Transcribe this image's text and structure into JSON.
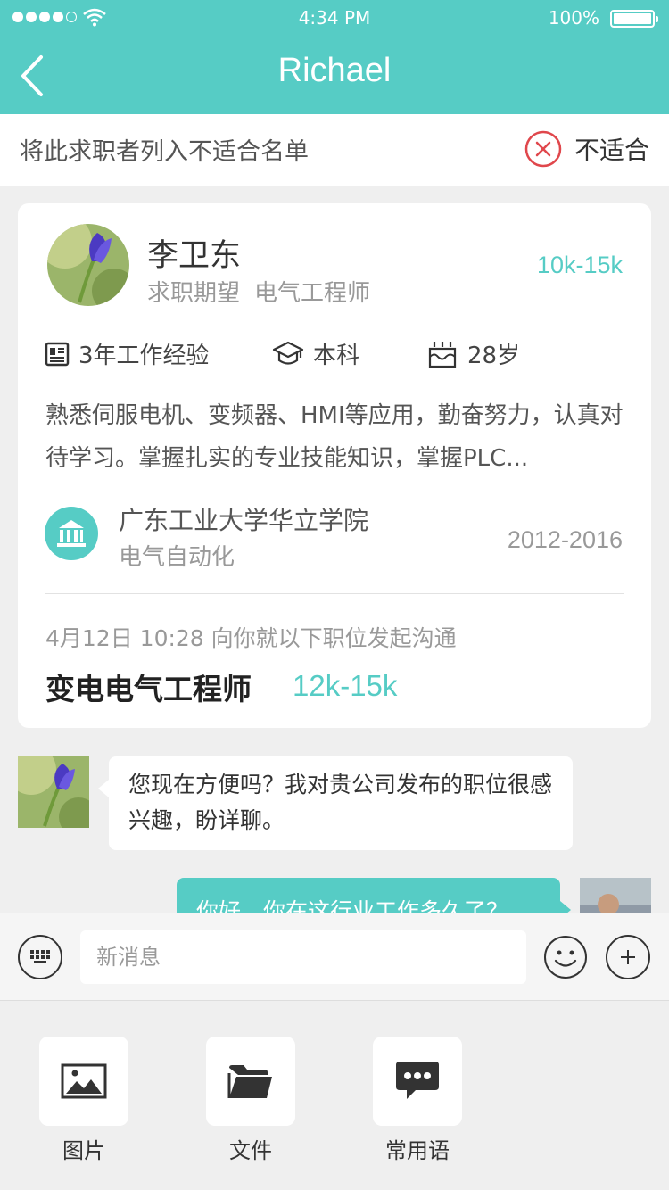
{
  "status_bar": {
    "time": "4:34 PM",
    "battery": "100%"
  },
  "nav": {
    "title": "Richael"
  },
  "reject_bar": {
    "text": "将此求职者列入不适合名单",
    "button_label": "不适合"
  },
  "candidate": {
    "name": "李卫东",
    "expect_label": "求职期望",
    "expect_position": "电气工程师",
    "salary": "10k-15k",
    "experience": "3年工作经验",
    "education": "本科",
    "age": "28岁",
    "description": "熟悉伺服电机、变频器、HMI等应用，勤奋努力，认真对待学习。掌握扎实的专业技能知识，掌握PLC...",
    "school": "广东工业大学华立学院",
    "major": "电气自动化",
    "years": "2012-2016"
  },
  "conversation_start": {
    "text": "4月12日 10:28 向你就以下职位发起沟通",
    "job_title": "变电电气工程师",
    "job_salary": "12k-15k"
  },
  "messages": [
    {
      "from": "candidate",
      "text": "您现在方便吗？我对贵公司发布的职位很感兴趣，盼详聊。"
    },
    {
      "from": "me",
      "text": "你好，你在这行业工作多久了？"
    }
  ],
  "input": {
    "placeholder": "新消息"
  },
  "tools": [
    {
      "label": "图片",
      "icon": "image-icon"
    },
    {
      "label": "文件",
      "icon": "folder-icon"
    },
    {
      "label": "常用语",
      "icon": "chat-icon"
    }
  ],
  "colors": {
    "accent": "#56ccc5",
    "reject": "#e0474c"
  }
}
